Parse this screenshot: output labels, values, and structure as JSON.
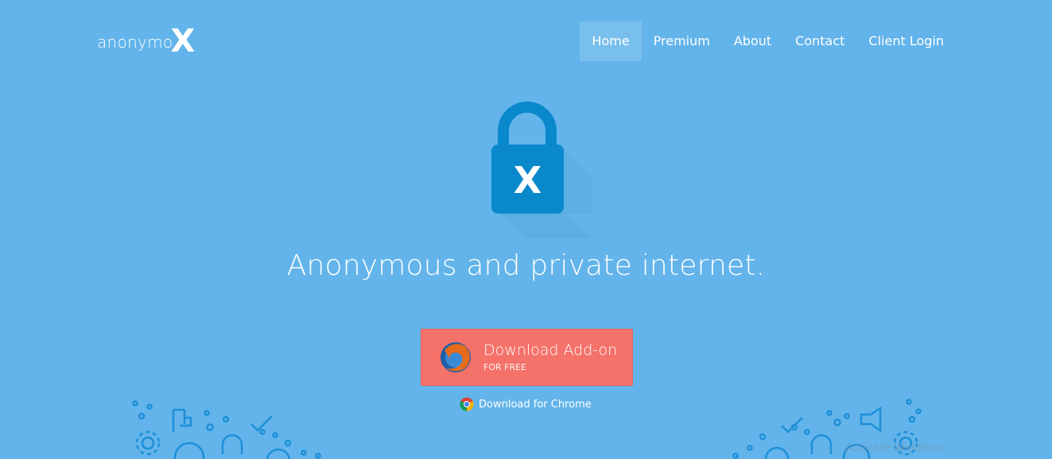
{
  "brand": {
    "name_text": "anonymo",
    "name_x": "X"
  },
  "nav": {
    "items": [
      {
        "label": "Home",
        "active": true
      },
      {
        "label": "Premium"
      },
      {
        "label": "About"
      },
      {
        "label": "Contact"
      },
      {
        "label": "Client Login"
      }
    ]
  },
  "hero": {
    "lock_icon": "padlock-x-icon",
    "lock_letter": "X",
    "headline": "Anonymous and private internet."
  },
  "download": {
    "title": "Download Add-on",
    "subtitle": "FOR FREE",
    "icon": "firefox-icon",
    "chrome_label": "Download for Chrome",
    "chrome_icon": "chrome-icon"
  },
  "watermark": "Activate Windows",
  "colors": {
    "background": "#62b4ea",
    "lock": "#0a88cc",
    "button": "#f4726a",
    "doodle": "#1e8fd8"
  }
}
